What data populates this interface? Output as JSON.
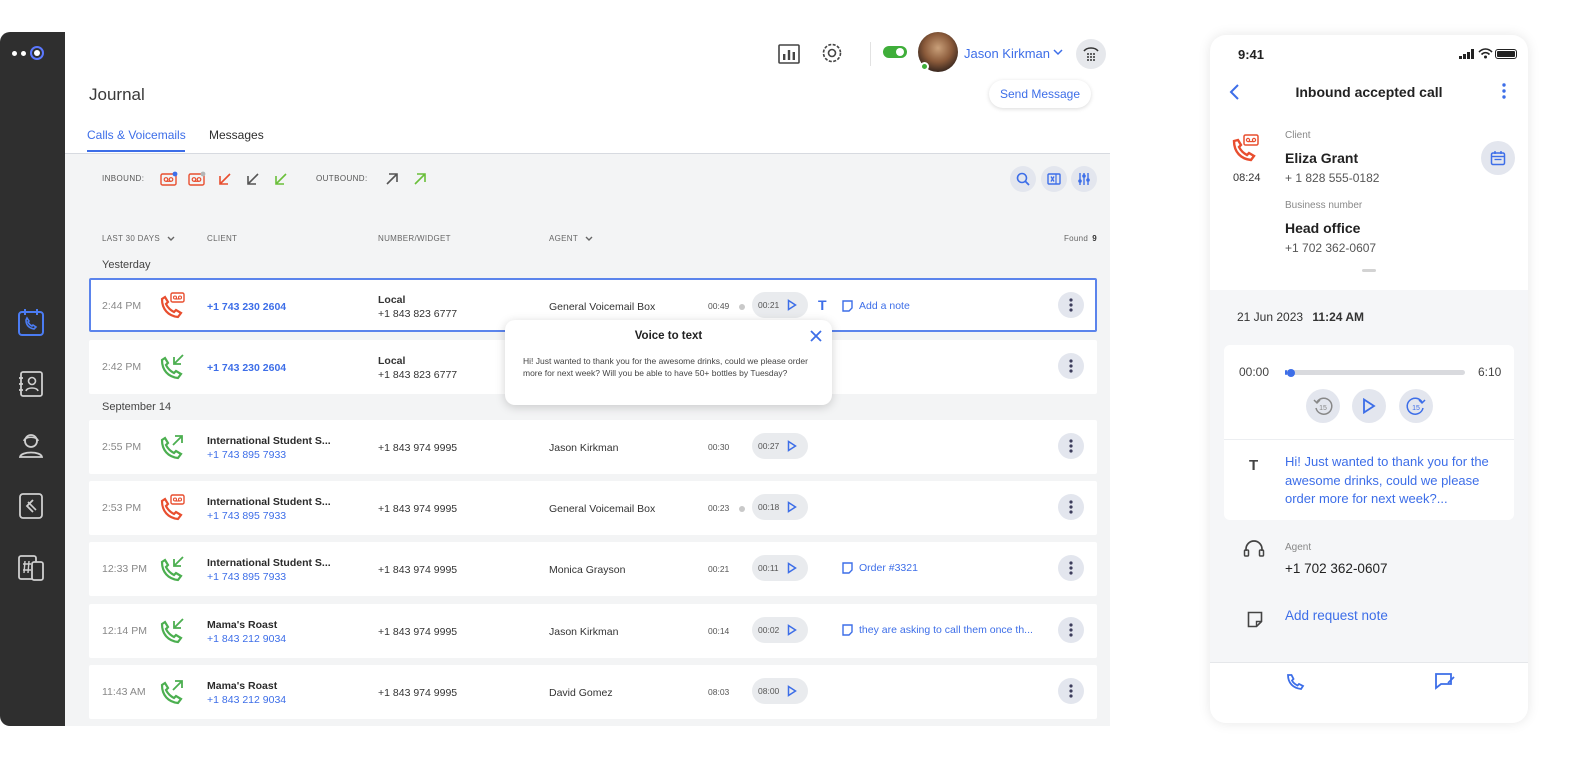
{
  "colors": {
    "accent": "#3d6ee8",
    "missed": "#e84e2f",
    "accepted": "#4caf50",
    "rail": "#2f2f2f"
  },
  "topbar": {
    "user_name": "Jason Kirkman",
    "icons": [
      "chart-icon",
      "settings-icon",
      "toggle-icon",
      "avatar",
      "dialpad-icon"
    ]
  },
  "journal": {
    "title": "Journal",
    "send_message": "Send Message",
    "tabs": [
      "Calls & Voicemails",
      "Messages"
    ],
    "inbound_label": "INBOUND:",
    "outbound_label": "OUTBOUND:",
    "columns": {
      "period": "LAST 30 DAYS",
      "client": "CLIENT",
      "number": "NUMBER/WIDGET",
      "agent": "AGENT",
      "found_label": "Found",
      "found_count": "9"
    },
    "groups": [
      "Yesterday",
      "September 14"
    ],
    "rows": [
      {
        "time": "2:44 PM",
        "type": "voicemail",
        "client_link": "+1 743 230 2604",
        "number_title": "Local",
        "number": "+1 843 823 6777",
        "agent": "General Voicemail Box",
        "duration": "00:49",
        "play": "00:21",
        "note": "Add a note",
        "has_text": true
      },
      {
        "time": "2:42 PM",
        "type": "inbound",
        "client_link": "+1 743 230 2604",
        "number_title": "Local",
        "number": "+1 843 823 6777"
      },
      {
        "time": "2:55 PM",
        "type": "outbound",
        "client_name": "International Student S...",
        "client_num": "+1 743 895 7933",
        "number": "+1 843 974 9995",
        "agent": "Jason Kirkman",
        "duration": "00:30",
        "play": "00:27"
      },
      {
        "time": "2:53 PM",
        "type": "voicemail",
        "client_name": "International Student S...",
        "client_num": "+1 743 895 7933",
        "number": "+1 843 974 9995",
        "agent": "General Voicemail Box",
        "duration": "00:23",
        "play": "00:18"
      },
      {
        "time": "12:33 PM",
        "type": "inbound",
        "client_name": "International Student S...",
        "client_num": "+1 743 895 7933",
        "number": "+1 843 974 9995",
        "agent": "Monica Grayson",
        "duration": "00:21",
        "play": "00:11",
        "note": "Order #3321"
      },
      {
        "time": "12:14 PM",
        "type": "inbound",
        "client_name": "Mama's Roast",
        "client_num": "+1 843 212 9034",
        "number": "+1 843 974 9995",
        "agent": "Jason Kirkman",
        "duration": "00:14",
        "play": "00:02",
        "note": "they are asking to call them once th..."
      },
      {
        "time": "11:43 AM",
        "type": "outbound",
        "client_name": "Mama's Roast",
        "client_num": "+1 843 212 9034",
        "number": "+1 843 974 9995",
        "agent": "David Gomez",
        "duration": "08:03",
        "play": "08:00"
      }
    ],
    "popup": {
      "title": "Voice to text",
      "body": "Hi! Just wanted to thank you for the awesome drinks, could we please order more for next week? Will you be able to have 50+ bottles by Tuesday?"
    }
  },
  "phone": {
    "status_time": "9:41",
    "title": "Inbound accepted call",
    "call_time": "08:24",
    "client_label": "Client",
    "client_name": "Eliza Grant",
    "client_number": "+ 1 828 555-0182",
    "business_label": "Business number",
    "business_name": "Head office",
    "business_number": "+1 702 362-0607",
    "date": "21 Jun 2023",
    "time": "11:24 AM",
    "player": {
      "start": "00:00",
      "end": "6:10",
      "progress": 0.01,
      "skip": "15"
    },
    "transcript": "Hi! Just wanted to thank you for the awesome drinks, could we please order more for next week?...",
    "agent_label": "Agent",
    "agent_number": "+1 702 362-0607",
    "request_note": "Add request note"
  }
}
